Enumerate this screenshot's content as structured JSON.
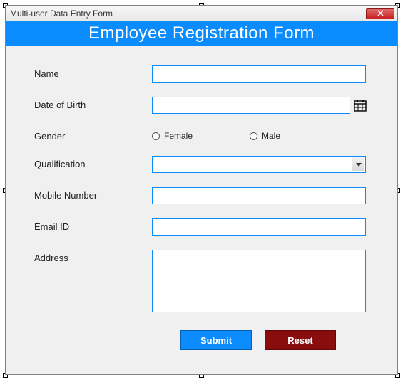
{
  "window": {
    "title": "Multi-user Data Entry Form"
  },
  "header": {
    "title": "Employee Registration Form"
  },
  "form": {
    "name": {
      "label": "Name",
      "value": ""
    },
    "dob": {
      "label": "Date of Birth",
      "value": ""
    },
    "gender": {
      "label": "Gender",
      "options": {
        "female": "Female",
        "male": "Male"
      },
      "value": ""
    },
    "qualification": {
      "label": "Qualification",
      "value": ""
    },
    "mobile": {
      "label": "Mobile Number",
      "value": ""
    },
    "email": {
      "label": "Email ID",
      "value": ""
    },
    "address": {
      "label": "Address",
      "value": ""
    }
  },
  "buttons": {
    "submit": "Submit",
    "reset": "Reset"
  },
  "colors": {
    "accent": "#0a8cff",
    "danger": "#8a0d0d"
  }
}
